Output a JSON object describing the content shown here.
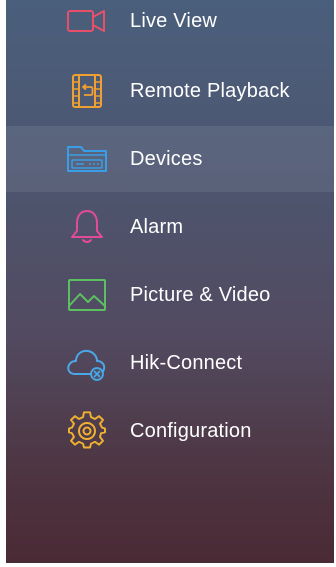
{
  "menu": {
    "items": [
      {
        "label": "Live View",
        "icon": "camera-icon",
        "color": "#e8506a"
      },
      {
        "label": "Remote Playback",
        "icon": "playback-icon",
        "color": "#f0a030"
      },
      {
        "label": "Devices",
        "icon": "dvr-device-icon",
        "color": "#3a9ee6",
        "selected": true
      },
      {
        "label": "Alarm",
        "icon": "bell-icon",
        "color": "#e24a9a"
      },
      {
        "label": "Picture & Video",
        "icon": "picture-icon",
        "color": "#5cc060"
      },
      {
        "label": "Hik-Connect",
        "icon": "cloud-icon",
        "color": "#4aa8e8"
      },
      {
        "label": "Configuration",
        "icon": "gear-icon",
        "color": "#f0b030"
      }
    ]
  }
}
